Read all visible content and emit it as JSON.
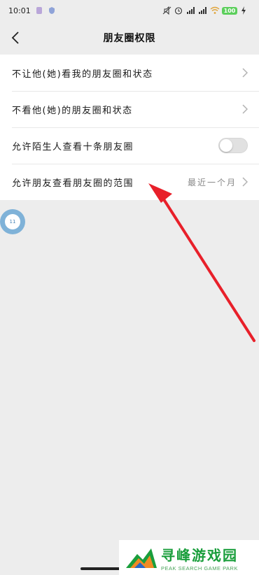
{
  "status_bar": {
    "time": "10:01",
    "battery": "100"
  },
  "header": {
    "title": "朋友圈权限"
  },
  "settings": [
    {
      "label": "不让他(她)看我的朋友圈和状态",
      "control": "chevron"
    },
    {
      "label": "不看他(她)的朋友圈和状态",
      "control": "chevron"
    },
    {
      "label": "允许陌生人查看十条朋友圈",
      "control": "toggle",
      "enabled": false
    },
    {
      "label": "允许朋友查看朋友圈的范围",
      "control": "chevron",
      "value": "最近一个月"
    }
  ],
  "float_bubble": {
    "text": "11"
  },
  "annotation": {
    "arrow_color": "#e8202a"
  },
  "watermark": {
    "title": "寻峰游戏园",
    "subtitle": "PEAK SEARCH GAME PARK"
  }
}
